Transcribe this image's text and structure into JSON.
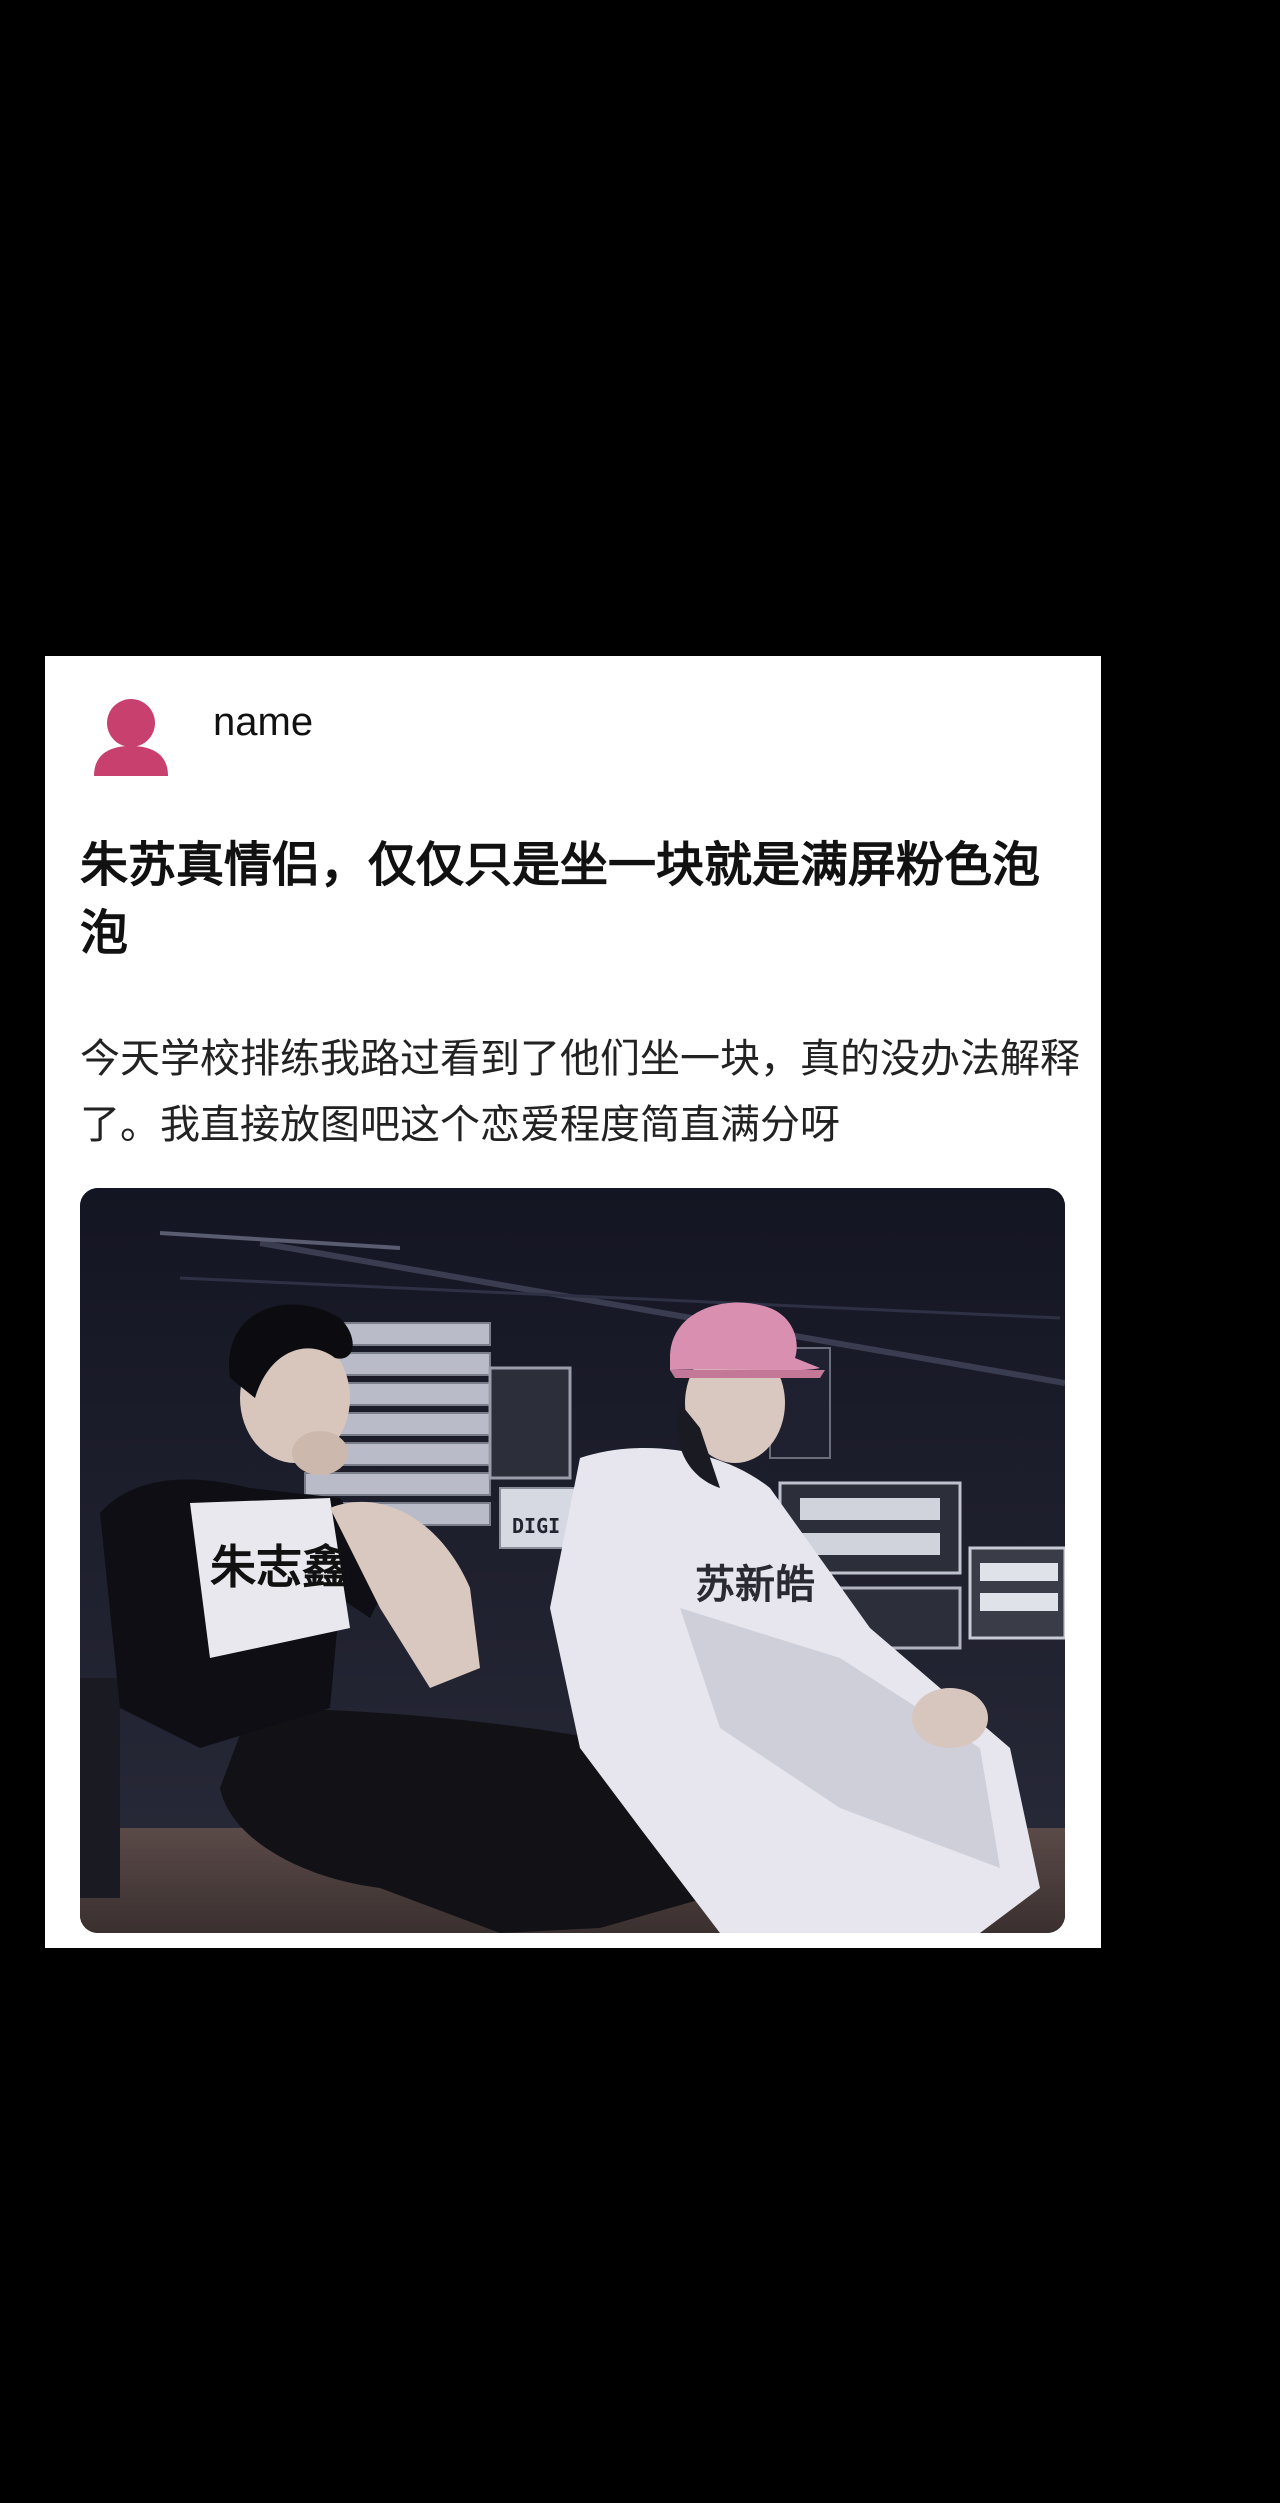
{
  "post": {
    "author": {
      "name": "name",
      "avatar_icon": "user-avatar-icon",
      "avatar_color": "#c8416e"
    },
    "title": "朱苏真情侣，仅仅只是坐一块就是满屏粉色泡泡",
    "body": "今天学校排练我路过看到了他们坐一块，真的没办法解释了。我直接放图吧这个恋爱程度简直满分呀",
    "photo": {
      "shirt_text_left": "朱志鑫",
      "shirt_text_right": "苏新皓",
      "equipment_text": "DIGI"
    }
  },
  "colors": {
    "page_background": "#000000",
    "card_background": "#ffffff",
    "text_primary": "#111111",
    "cap_pink": "#d98fb0"
  }
}
